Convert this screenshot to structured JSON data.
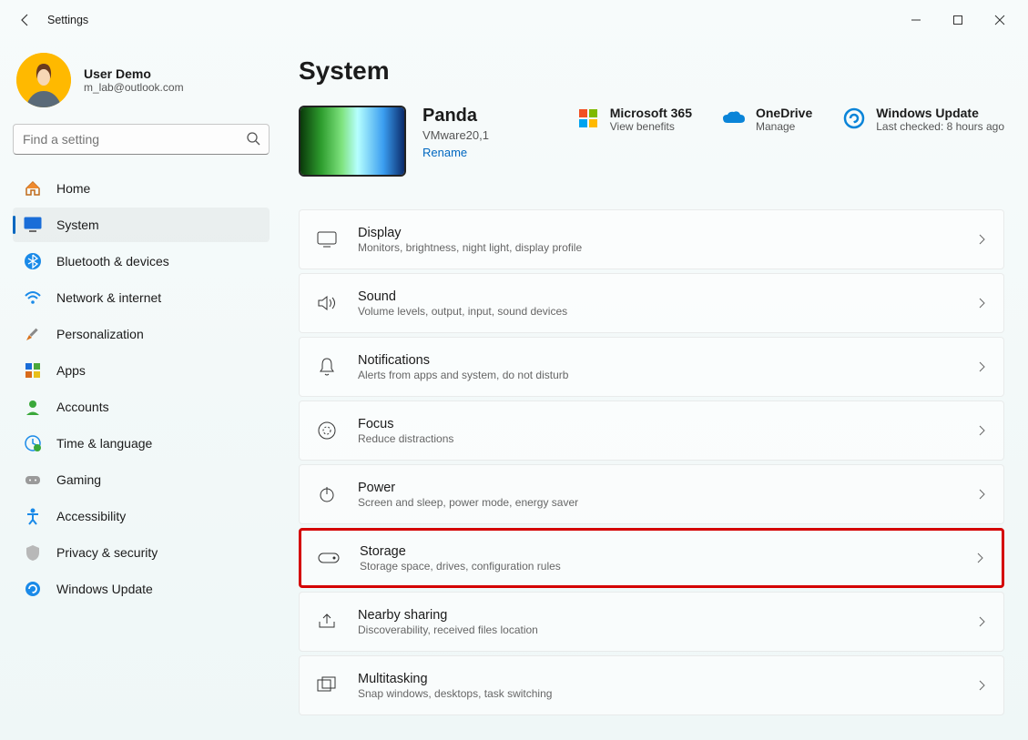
{
  "window": {
    "title": "Settings"
  },
  "user": {
    "name": "User Demo",
    "email": "m_lab@outlook.com"
  },
  "search": {
    "placeholder": "Find a setting"
  },
  "nav": {
    "items": [
      {
        "label": "Home"
      },
      {
        "label": "System"
      },
      {
        "label": "Bluetooth & devices"
      },
      {
        "label": "Network & internet"
      },
      {
        "label": "Personalization"
      },
      {
        "label": "Apps"
      },
      {
        "label": "Accounts"
      },
      {
        "label": "Time & language"
      },
      {
        "label": "Gaming"
      },
      {
        "label": "Accessibility"
      },
      {
        "label": "Privacy & security"
      },
      {
        "label": "Windows Update"
      }
    ]
  },
  "page": {
    "title": "System"
  },
  "device": {
    "name": "Panda",
    "model": "VMware20,1",
    "rename": "Rename"
  },
  "cards": {
    "ms365": {
      "title": "Microsoft 365",
      "sub": "View benefits"
    },
    "onedrive": {
      "title": "OneDrive",
      "sub": "Manage"
    },
    "update": {
      "title": "Windows Update",
      "sub": "Last checked: 8 hours ago"
    }
  },
  "items": [
    {
      "title": "Display",
      "sub": "Monitors, brightness, night light, display profile"
    },
    {
      "title": "Sound",
      "sub": "Volume levels, output, input, sound devices"
    },
    {
      "title": "Notifications",
      "sub": "Alerts from apps and system, do not disturb"
    },
    {
      "title": "Focus",
      "sub": "Reduce distractions"
    },
    {
      "title": "Power",
      "sub": "Screen and sleep, power mode, energy saver"
    },
    {
      "title": "Storage",
      "sub": "Storage space, drives, configuration rules"
    },
    {
      "title": "Nearby sharing",
      "sub": "Discoverability, received files location"
    },
    {
      "title": "Multitasking",
      "sub": "Snap windows, desktops, task switching"
    }
  ]
}
